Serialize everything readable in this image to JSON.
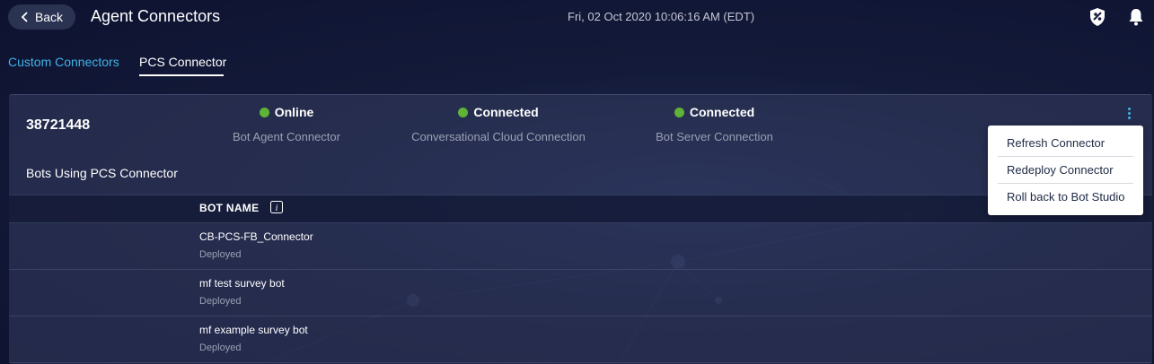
{
  "header": {
    "back_label": "Back",
    "title": "Agent Connectors",
    "datetime": "Fri, 02 Oct 2020 10:06:16 AM (EDT)",
    "icons": [
      "shield-icon",
      "bell-icon"
    ]
  },
  "tabs": [
    {
      "label": "Custom Connectors",
      "active": false
    },
    {
      "label": "PCS Connector",
      "active": true
    }
  ],
  "connector": {
    "id": "38721448",
    "statuses": [
      {
        "value": "Online",
        "label": "Bot Agent Connector",
        "color": "#5fb336"
      },
      {
        "value": "Connected",
        "label": "Conversational Cloud Connection",
        "color": "#5fb336"
      },
      {
        "value": "Connected",
        "label": "Bot Server Connection",
        "color": "#5fb336"
      }
    ]
  },
  "menu": {
    "items": [
      "Refresh Connector",
      "Redeploy Connector",
      "Roll back to Bot Studio"
    ]
  },
  "bots": {
    "heading": "Bots Using PCS Connector",
    "column_header": "BOT NAME",
    "rows": [
      {
        "name": "CB-PCS-FB_Connector",
        "status": "Deployed"
      },
      {
        "name": "mf test survey bot",
        "status": "Deployed"
      },
      {
        "name": "mf example survey bot",
        "status": "Deployed"
      }
    ]
  },
  "colors": {
    "accent": "#3fb3e8",
    "status_green": "#5fb336",
    "background": "#141b3a"
  }
}
